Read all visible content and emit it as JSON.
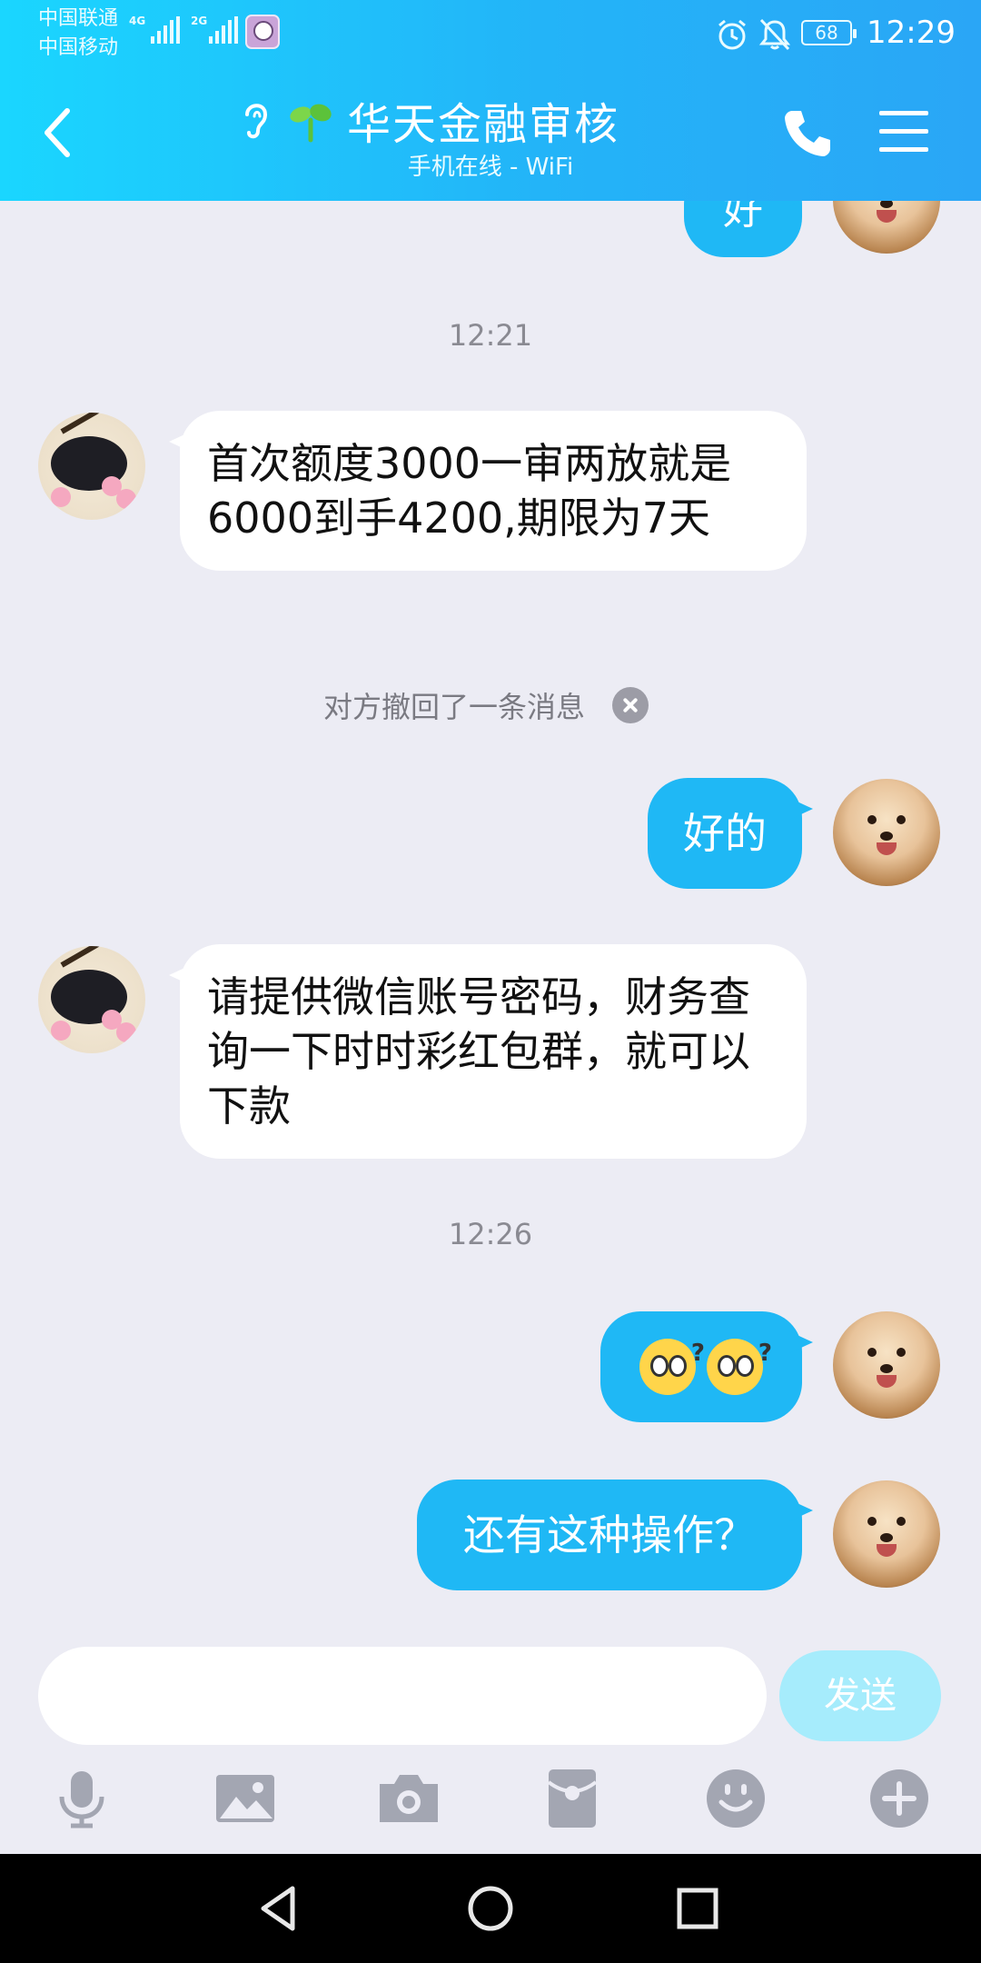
{
  "status_bar": {
    "carrier1": "中国联通",
    "carrier2": "中国移动",
    "net1": "4G",
    "net2": "2G",
    "battery": "68",
    "time": "12:29"
  },
  "header": {
    "title": "华天金融审核",
    "subtitle": "手机在线 - WiFi"
  },
  "messages": {
    "partial_out": "好",
    "ts1": "12:21",
    "in1": "首次额度3000一审两放就是6000到手4200,期限为7天",
    "recall_notice": "对方撤回了一条消息",
    "out1": "好的",
    "in2": "请提供微信账号密码，财务查询一下时时彩红包群，就可以下款",
    "ts2": "12:26",
    "out2_emoji_q": "?",
    "out3": "还有这种操作？"
  },
  "input": {
    "placeholder": "",
    "value": "",
    "send_label": "发送"
  },
  "toolbar_icons": [
    "microphone-icon",
    "image-icon",
    "camera-icon",
    "red-packet-icon",
    "emoji-icon",
    "plus-icon"
  ],
  "colors": {
    "header_start": "#1ad6ff",
    "header_end": "#2aa6f6",
    "bubble_out": "#1fb8f5",
    "send_button": "#a6ecfc",
    "background": "#ececf4"
  }
}
